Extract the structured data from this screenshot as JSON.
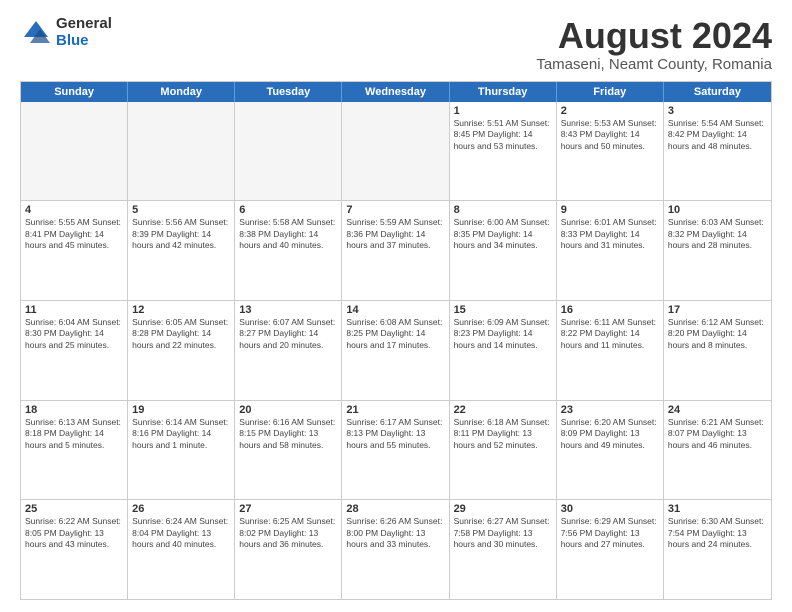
{
  "logo": {
    "general": "General",
    "blue": "Blue"
  },
  "header": {
    "title": "August 2024",
    "subtitle": "Tamaseni, Neamt County, Romania"
  },
  "days": [
    "Sunday",
    "Monday",
    "Tuesday",
    "Wednesday",
    "Thursday",
    "Friday",
    "Saturday"
  ],
  "weeks": [
    [
      {
        "day": "",
        "info": ""
      },
      {
        "day": "",
        "info": ""
      },
      {
        "day": "",
        "info": ""
      },
      {
        "day": "",
        "info": ""
      },
      {
        "day": "1",
        "info": "Sunrise: 5:51 AM\nSunset: 8:45 PM\nDaylight: 14 hours\nand 53 minutes."
      },
      {
        "day": "2",
        "info": "Sunrise: 5:53 AM\nSunset: 8:43 PM\nDaylight: 14 hours\nand 50 minutes."
      },
      {
        "day": "3",
        "info": "Sunrise: 5:54 AM\nSunset: 8:42 PM\nDaylight: 14 hours\nand 48 minutes."
      }
    ],
    [
      {
        "day": "4",
        "info": "Sunrise: 5:55 AM\nSunset: 8:41 PM\nDaylight: 14 hours\nand 45 minutes."
      },
      {
        "day": "5",
        "info": "Sunrise: 5:56 AM\nSunset: 8:39 PM\nDaylight: 14 hours\nand 42 minutes."
      },
      {
        "day": "6",
        "info": "Sunrise: 5:58 AM\nSunset: 8:38 PM\nDaylight: 14 hours\nand 40 minutes."
      },
      {
        "day": "7",
        "info": "Sunrise: 5:59 AM\nSunset: 8:36 PM\nDaylight: 14 hours\nand 37 minutes."
      },
      {
        "day": "8",
        "info": "Sunrise: 6:00 AM\nSunset: 8:35 PM\nDaylight: 14 hours\nand 34 minutes."
      },
      {
        "day": "9",
        "info": "Sunrise: 6:01 AM\nSunset: 8:33 PM\nDaylight: 14 hours\nand 31 minutes."
      },
      {
        "day": "10",
        "info": "Sunrise: 6:03 AM\nSunset: 8:32 PM\nDaylight: 14 hours\nand 28 minutes."
      }
    ],
    [
      {
        "day": "11",
        "info": "Sunrise: 6:04 AM\nSunset: 8:30 PM\nDaylight: 14 hours\nand 25 minutes."
      },
      {
        "day": "12",
        "info": "Sunrise: 6:05 AM\nSunset: 8:28 PM\nDaylight: 14 hours\nand 22 minutes."
      },
      {
        "day": "13",
        "info": "Sunrise: 6:07 AM\nSunset: 8:27 PM\nDaylight: 14 hours\nand 20 minutes."
      },
      {
        "day": "14",
        "info": "Sunrise: 6:08 AM\nSunset: 8:25 PM\nDaylight: 14 hours\nand 17 minutes."
      },
      {
        "day": "15",
        "info": "Sunrise: 6:09 AM\nSunset: 8:23 PM\nDaylight: 14 hours\nand 14 minutes."
      },
      {
        "day": "16",
        "info": "Sunrise: 6:11 AM\nSunset: 8:22 PM\nDaylight: 14 hours\nand 11 minutes."
      },
      {
        "day": "17",
        "info": "Sunrise: 6:12 AM\nSunset: 8:20 PM\nDaylight: 14 hours\nand 8 minutes."
      }
    ],
    [
      {
        "day": "18",
        "info": "Sunrise: 6:13 AM\nSunset: 8:18 PM\nDaylight: 14 hours\nand 5 minutes."
      },
      {
        "day": "19",
        "info": "Sunrise: 6:14 AM\nSunset: 8:16 PM\nDaylight: 14 hours\nand 1 minute."
      },
      {
        "day": "20",
        "info": "Sunrise: 6:16 AM\nSunset: 8:15 PM\nDaylight: 13 hours\nand 58 minutes."
      },
      {
        "day": "21",
        "info": "Sunrise: 6:17 AM\nSunset: 8:13 PM\nDaylight: 13 hours\nand 55 minutes."
      },
      {
        "day": "22",
        "info": "Sunrise: 6:18 AM\nSunset: 8:11 PM\nDaylight: 13 hours\nand 52 minutes."
      },
      {
        "day": "23",
        "info": "Sunrise: 6:20 AM\nSunset: 8:09 PM\nDaylight: 13 hours\nand 49 minutes."
      },
      {
        "day": "24",
        "info": "Sunrise: 6:21 AM\nSunset: 8:07 PM\nDaylight: 13 hours\nand 46 minutes."
      }
    ],
    [
      {
        "day": "25",
        "info": "Sunrise: 6:22 AM\nSunset: 8:05 PM\nDaylight: 13 hours\nand 43 minutes."
      },
      {
        "day": "26",
        "info": "Sunrise: 6:24 AM\nSunset: 8:04 PM\nDaylight: 13 hours\nand 40 minutes."
      },
      {
        "day": "27",
        "info": "Sunrise: 6:25 AM\nSunset: 8:02 PM\nDaylight: 13 hours\nand 36 minutes."
      },
      {
        "day": "28",
        "info": "Sunrise: 6:26 AM\nSunset: 8:00 PM\nDaylight: 13 hours\nand 33 minutes."
      },
      {
        "day": "29",
        "info": "Sunrise: 6:27 AM\nSunset: 7:58 PM\nDaylight: 13 hours\nand 30 minutes."
      },
      {
        "day": "30",
        "info": "Sunrise: 6:29 AM\nSunset: 7:56 PM\nDaylight: 13 hours\nand 27 minutes."
      },
      {
        "day": "31",
        "info": "Sunrise: 6:30 AM\nSunset: 7:54 PM\nDaylight: 13 hours\nand 24 minutes."
      }
    ]
  ]
}
